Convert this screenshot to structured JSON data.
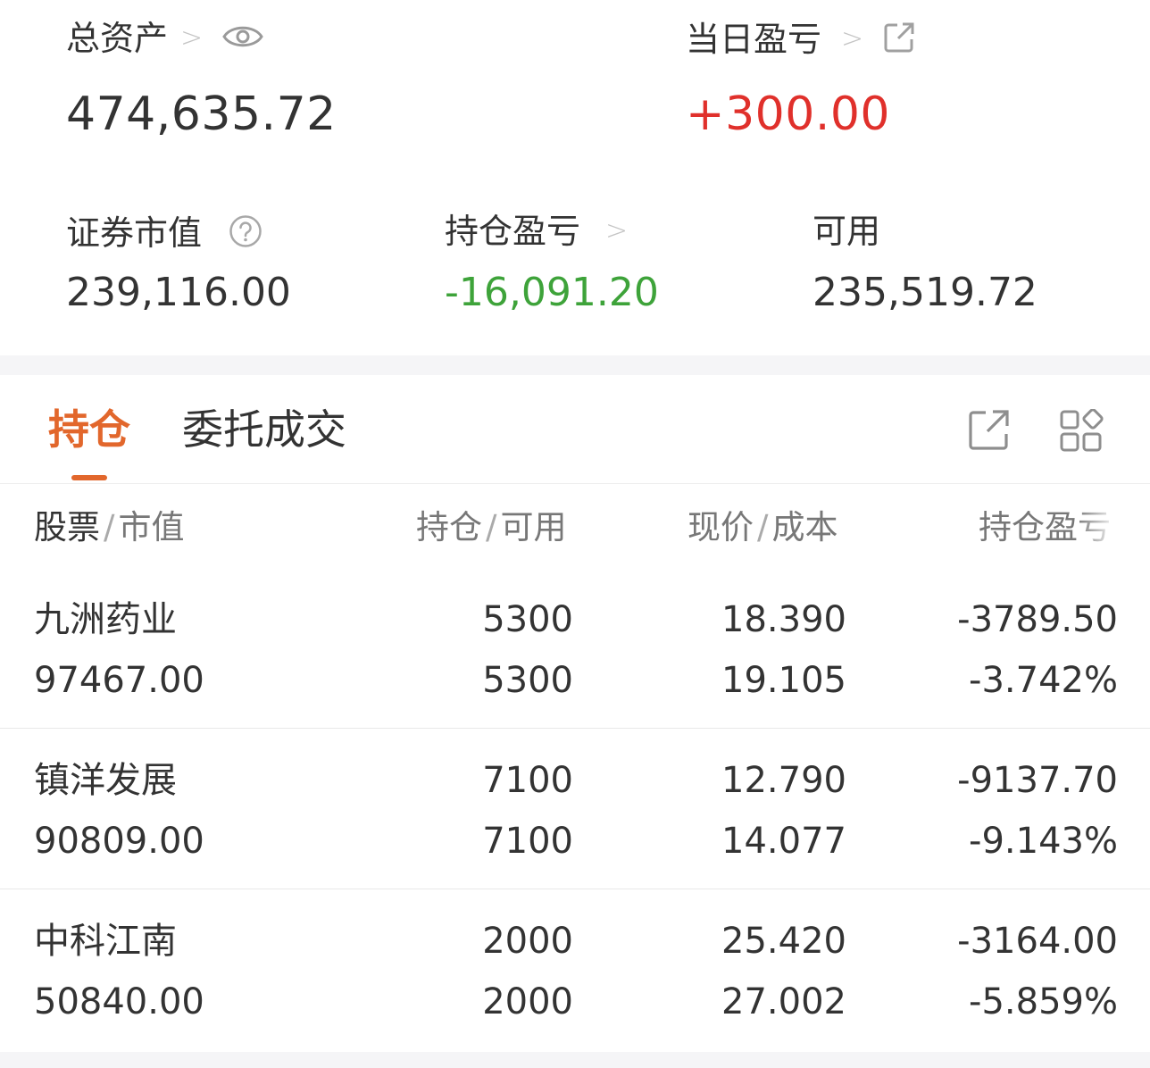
{
  "summary": {
    "total_assets_label": "总资产",
    "total_assets_value": "474,635.72",
    "daily_pnl_label": "当日盈亏",
    "daily_pnl_value": "+300.00",
    "market_value_label": "证券市值",
    "market_value_value": "239,116.00",
    "position_pnl_label": "持仓盈亏",
    "position_pnl_value": "-16,091.20",
    "available_label": "可用",
    "available_value": "235,519.72",
    "chevron": ">"
  },
  "tabs": {
    "positions": "持仓",
    "orders": "委托成交"
  },
  "table": {
    "headers": {
      "stock": "股票",
      "market_value": "市值",
      "holding": "持仓",
      "available": "可用",
      "price": "现价",
      "cost": "成本",
      "pnl": "持仓盈亏",
      "sep": "/"
    },
    "rows": [
      {
        "name": "九洲药业",
        "market_value": "97467.00",
        "holding": "5300",
        "available": "5300",
        "price": "18.390",
        "cost": "19.105",
        "pnl": "-3789.50",
        "pnl_pct": "-3.742%"
      },
      {
        "name": "镇洋发展",
        "market_value": "90809.00",
        "holding": "7100",
        "available": "7100",
        "price": "12.790",
        "cost": "14.077",
        "pnl": "-9137.70",
        "pnl_pct": "-9.143%"
      },
      {
        "name": "中科江南",
        "market_value": "50840.00",
        "holding": "2000",
        "available": "2000",
        "price": "25.420",
        "cost": "27.002",
        "pnl": "-3164.00",
        "pnl_pct": "-5.859%"
      }
    ]
  },
  "colors": {
    "accent": "#e2672c",
    "up_red": "#e0302b",
    "down_green": "#3ea33a"
  },
  "icons": [
    "eye-icon",
    "external-link-icon",
    "help-circle-icon",
    "share-icon",
    "grid-icon",
    "chevron-right-icon"
  ]
}
